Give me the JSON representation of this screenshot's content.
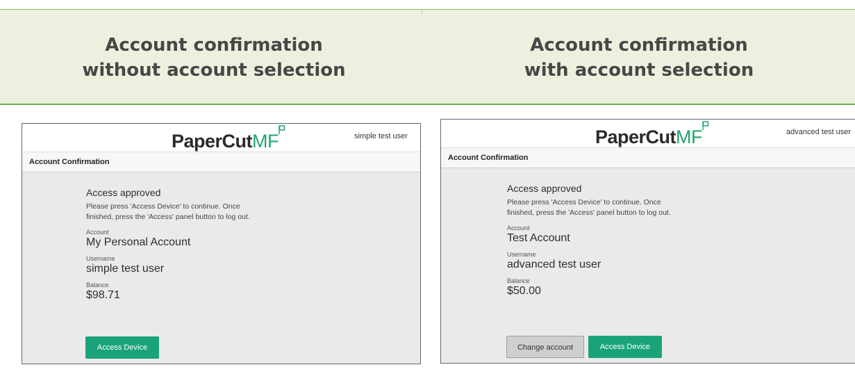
{
  "headers": {
    "left": [
      "Account confirmation",
      "without account selection"
    ],
    "right": [
      "Account confirmation",
      "with account selection"
    ]
  },
  "left_panel": {
    "logo_main": "PaperCut",
    "logo_suffix": "MF",
    "user": "simple test user",
    "title": "Account Confirmation",
    "status": "Access approved",
    "description": "Please press 'Access Device' to continue. Once finished, press the 'Access' panel button to log out.",
    "account_label": "Account",
    "account_value": "My Personal Account",
    "username_label": "Username",
    "username_value": "simple test user",
    "balance_label": "Balance",
    "balance_value": "$98.71",
    "access_button": "Access Device"
  },
  "right_panel": {
    "logo_main": "PaperCut",
    "logo_suffix": "MF",
    "user": "advanced test user",
    "title": "Account Confirmation",
    "status": "Access approved",
    "description": "Please press 'Access Device' to continue. Once finished, press the 'Access' panel button to log out.",
    "account_label": "Account",
    "account_value": "Test Account",
    "username_label": "Username",
    "username_value": "advanced test user",
    "balance_label": "Balance",
    "balance_value": "$50.00",
    "change_button": "Change account",
    "access_button": "Access Device"
  },
  "colors": {
    "brand_green": "#1aa37a",
    "header_band": "#ebf1de",
    "panel_bg": "#eaeaea"
  }
}
